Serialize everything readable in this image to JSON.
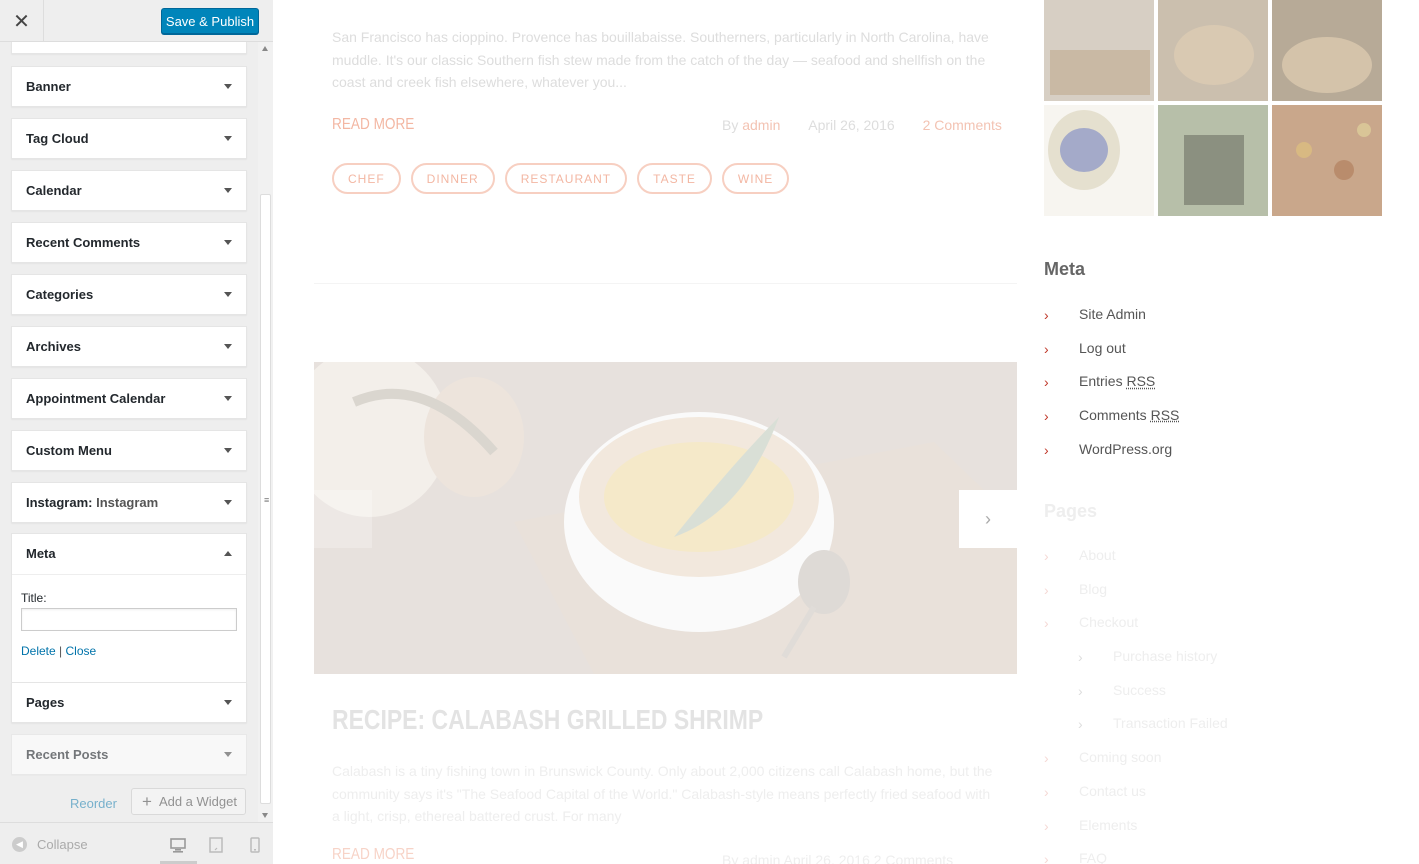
{
  "header": {
    "close_icon": "close-icon",
    "publish_label": "Save & Publish"
  },
  "widgets": [
    {
      "name": "widget-banner",
      "title": "Banner"
    },
    {
      "name": "widget-tag-cloud",
      "title": "Tag Cloud"
    },
    {
      "name": "widget-calendar",
      "title": "Calendar"
    },
    {
      "name": "widget-recent-comments",
      "title": "Recent Comments"
    },
    {
      "name": "widget-categories",
      "title": "Categories"
    },
    {
      "name": "widget-archives",
      "title": "Archives"
    },
    {
      "name": "widget-appointment-calendar",
      "title": "Appointment Calendar"
    },
    {
      "name": "widget-custom-menu",
      "title": "Custom Menu"
    }
  ],
  "instagram_widget": {
    "title": "Instagram:",
    "subtitle": "Instagram"
  },
  "meta_widget": {
    "title": "Meta",
    "title_label": "Title:",
    "title_value": "",
    "delete_label": "Delete",
    "separator": "|",
    "close_label": "Close"
  },
  "lower_widgets": [
    {
      "name": "widget-pages",
      "title": "Pages"
    },
    {
      "name": "widget-recent-posts",
      "title": "Recent Posts"
    }
  ],
  "footer": {
    "reorder_label": "Reorder",
    "add_widget_label": "Add a Widget",
    "collapse_label": "Collapse"
  },
  "preview": {
    "excerpt": "San Francisco has cioppino. Provence has bouillabaisse. Southerners, particularly in North Carolina, have muddle. It's our classic Southern fish stew made from the catch of the day — seafood and shellfish on the coast and creek fish elsewhere, whatever you...",
    "read_more": "READ MORE",
    "by": "By",
    "author": "admin",
    "date": "April 26, 2016",
    "comments": "2 Comments",
    "tags": [
      "CHEF",
      "DINNER",
      "RESTAURANT",
      "TASTE",
      "WINE"
    ],
    "post_title": "RECIPE: CALABASH GRILLED SHRIMP",
    "post_excerpt": "Calabash is a tiny fishing town in Brunswick County. Only about 2,000 citizens call Calabash home, but the community says it's \"The Seafood Capital of the World.\" Calabash-style means perfectly fried seafood with a light, crisp, ethereal battered crust. For many",
    "read_more_2": "READ MORE",
    "meta2": "By admin    April 26, 2016    2 Comments",
    "next_arrow": "›",
    "sidebar_meta_title": "Meta",
    "meta_links": [
      {
        "text": "Site Admin"
      },
      {
        "text": "Log out"
      },
      {
        "text": "Entries ",
        "abbr": "RSS"
      },
      {
        "text": "Comments ",
        "abbr": "RSS"
      },
      {
        "text": "WordPress.org"
      }
    ],
    "pages_title": "Pages",
    "pages_links": [
      {
        "text": "About",
        "sub": false
      },
      {
        "text": "Blog",
        "sub": false
      },
      {
        "text": "Checkout",
        "sub": false
      },
      {
        "text": "Purchase history",
        "sub": true
      },
      {
        "text": "Success",
        "sub": true
      },
      {
        "text": "Transaction Failed",
        "sub": true
      },
      {
        "text": "Coming soon",
        "sub": false
      },
      {
        "text": "Contact us",
        "sub": false
      },
      {
        "text": "Elements",
        "sub": false
      },
      {
        "text": "FAQ",
        "sub": false
      }
    ]
  }
}
